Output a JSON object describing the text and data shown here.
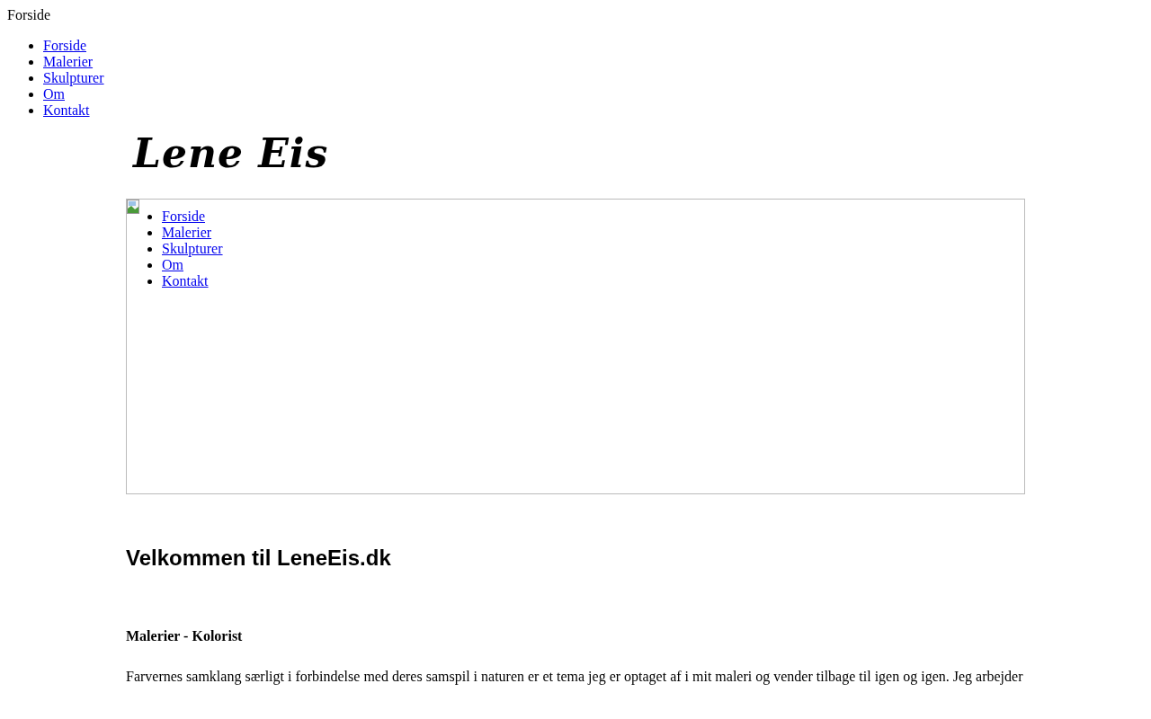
{
  "page_title": "Forside",
  "top_nav": [
    {
      "label": "Forside"
    },
    {
      "label": "Malerier"
    },
    {
      "label": "Skulpturer"
    },
    {
      "label": "Om"
    },
    {
      "label": "Kontakt"
    }
  ],
  "logo": "Lene Eis",
  "banner_nav": [
    {
      "label": "Forside"
    },
    {
      "label": "Malerier"
    },
    {
      "label": "Skulpturer"
    },
    {
      "label": "Om"
    },
    {
      "label": "Kontakt"
    }
  ],
  "heading": "Velkommen til LeneEis.dk",
  "subheading": "Malerier - Kolorist",
  "paragraph": "Farvernes samklang særligt i forbindelse med deres samspil i naturen er et tema jeg er optaget af i mit maleri og vender tilbage til igen og igen. Jeg arbejder"
}
